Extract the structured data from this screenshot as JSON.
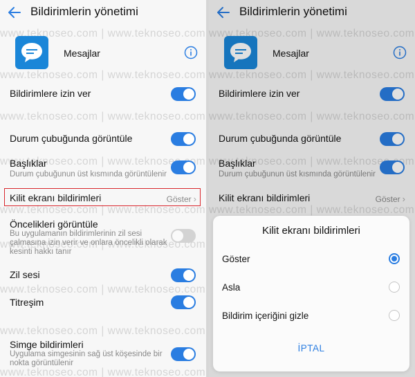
{
  "screen": {
    "title": "Bildirimlerin yönetimi",
    "app_name": "Mesajlar",
    "watermark": "www.teknoseo.com | www.teknoseo.com | www.teknoseo.com",
    "accent_color": "#2a7de1",
    "highlight_color": "#d9262c"
  },
  "settings": {
    "allow": {
      "title": "Bildirimlere izin ver",
      "toggle_on": true
    },
    "status_bar": {
      "title": "Durum çubuğunda görüntüle",
      "toggle_on": true
    },
    "banners": {
      "title": "Başlıklar",
      "subtitle": "Durum çubuğunun üst kısmında görüntülenir",
      "toggle_on": true
    },
    "lock_screen": {
      "title": "Kilit ekranı bildirimleri",
      "value": "Göster"
    },
    "priority": {
      "title": "Öncelikleri görüntüle",
      "subtitle_1": "Bu uygulamanın bildirimlerinin zil sesi",
      "subtitle_2": "çalmasına izin verir ve onlara öncelikli olarak",
      "subtitle_3": "kesinti hakkı tanır",
      "toggle_on": false
    },
    "ringtone": {
      "title": "Zil sesi",
      "toggle_on": true
    },
    "vibration": {
      "title": "Titreşim",
      "toggle_on": true
    },
    "badge": {
      "title": "Simge bildirimleri",
      "subtitle_1": "Uygulama simgesinin sağ üst köşesinde bir",
      "subtitle_2": "nokta görüntülenir",
      "toggle_on": true
    }
  },
  "dialog": {
    "title": "Kilit ekranı bildirimleri",
    "options": [
      "Göster",
      "Asla",
      "Bildirim içeriğini gizle"
    ],
    "selected": "Göster",
    "cancel": "İPTAL"
  },
  "icons": [
    "back-arrow-icon",
    "messages-icon",
    "info-icon",
    "chevron-right-icon"
  ]
}
